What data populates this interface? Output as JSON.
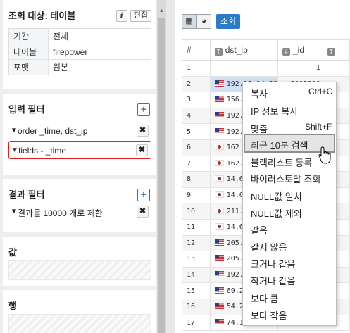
{
  "target_panel": {
    "title": "조회 대상: 테이블",
    "info_label": "i",
    "edit_label": "편집",
    "rows": [
      {
        "key": "기간",
        "value": "전체"
      },
      {
        "key": "테이블",
        "value": "firepower"
      },
      {
        "key": "포맷",
        "value": "원본"
      }
    ]
  },
  "input_filter": {
    "title": "입력 필터",
    "add_label": "+",
    "filters": [
      {
        "text": "order _time, dst_ip",
        "remove": "✖"
      },
      {
        "text": "fields - _time",
        "remove": "✖"
      }
    ]
  },
  "result_filter": {
    "title": "결과 필터",
    "add_label": "+",
    "filters": [
      {
        "text": "결과를 10000 개로 제한",
        "remove": "✖"
      }
    ]
  },
  "value_panel": {
    "title": "값"
  },
  "row_panel": {
    "title": "행"
  },
  "toolbar": {
    "table_icon": "table-icon",
    "chart_icon": "pie-chart-icon",
    "query_label": "조회"
  },
  "grid": {
    "columns": [
      "#",
      "dst_ip",
      "_id",
      ""
    ],
    "column_tags": [
      "",
      "T",
      "#",
      "T"
    ],
    "rows": [
      {
        "n": "1",
        "ip": "",
        "id": "1",
        "flag": ""
      },
      {
        "n": "2",
        "ip": "192.12.14.28",
        "id": "2902890",
        "flag": "us"
      },
      {
        "n": "3",
        "ip": "156.",
        "id": "",
        "flag": "us"
      },
      {
        "n": "4",
        "ip": "192.",
        "id": "",
        "flag": "us"
      },
      {
        "n": "5",
        "ip": "192.",
        "id": "",
        "flag": "us"
      },
      {
        "n": "6",
        "ip": "162",
        "id": "",
        "flag": "jp"
      },
      {
        "n": "7",
        "ip": "162.",
        "id": "",
        "flag": "jp"
      },
      {
        "n": "8",
        "ip": "14.6",
        "id": "",
        "flag": "kr"
      },
      {
        "n": "9",
        "ip": "14.6",
        "id": "",
        "flag": "kr"
      },
      {
        "n": "10",
        "ip": "211.",
        "id": "",
        "flag": "kr"
      },
      {
        "n": "11",
        "ip": "14.6",
        "id": "",
        "flag": "kr"
      },
      {
        "n": "12",
        "ip": "205.",
        "id": "",
        "flag": "us"
      },
      {
        "n": "13",
        "ip": "205.",
        "id": "",
        "flag": "us"
      },
      {
        "n": "14",
        "ip": "192.",
        "id": "",
        "flag": "us"
      },
      {
        "n": "15",
        "ip": "69.2",
        "id": "",
        "flag": "us"
      },
      {
        "n": "16",
        "ip": "54.2",
        "id": "",
        "flag": "us"
      },
      {
        "n": "17",
        "ip": "74.1",
        "id": "",
        "flag": "us"
      }
    ]
  },
  "context_menu": {
    "items": [
      {
        "label": "복사",
        "shortcut": "Ctrl+C"
      },
      {
        "label": "IP 정보 복사",
        "shortcut": ""
      },
      {
        "label": "맞춤",
        "shortcut": "Shift+F"
      },
      {
        "label": "최근 10분 검색",
        "shortcut": ""
      },
      {
        "label": "블랙리스트 등록",
        "shortcut": ""
      },
      {
        "label": "바이러스토탈 조회",
        "shortcut": ""
      },
      {
        "label": "NULL값 일치",
        "shortcut": ""
      },
      {
        "label": "NULL값 제외",
        "shortcut": ""
      },
      {
        "label": "같음",
        "shortcut": ""
      },
      {
        "label": "같지 않음",
        "shortcut": ""
      },
      {
        "label": "크거나 같음",
        "shortcut": ""
      },
      {
        "label": "작거나 같음",
        "shortcut": ""
      },
      {
        "label": "보다 큼",
        "shortcut": ""
      },
      {
        "label": "보다 작음",
        "shortcut": ""
      }
    ],
    "highlighted_index": 3
  },
  "colors": {
    "accent": "#2a7cc7",
    "highlight_border": "#e02020"
  }
}
